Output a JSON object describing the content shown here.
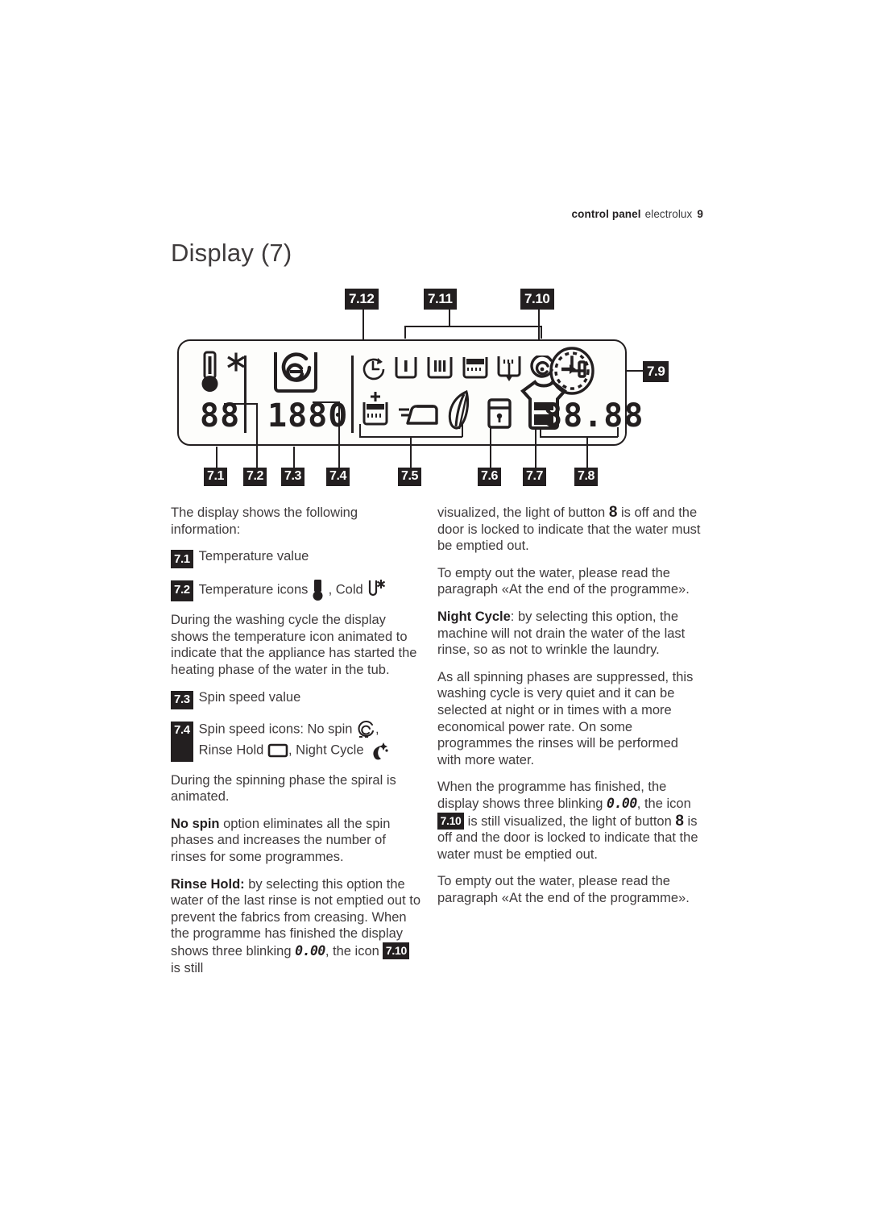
{
  "header": {
    "section": "control panel",
    "brand": "electrolux",
    "page_number": "9"
  },
  "title": "Display (7)",
  "figure": {
    "callouts_top": [
      "7.12",
      "7.11",
      "7.10"
    ],
    "callout_right": "7.9",
    "callouts_bottom": [
      "7.1",
      "7.2",
      "7.3",
      "7.4",
      "7.5",
      "7.6",
      "7.7",
      "7.8"
    ],
    "segments": {
      "temperature_value": "88",
      "spin_speed_value": "1880",
      "time_value": "88.88"
    },
    "icon_names": [
      "thermometer-icon",
      "snowflake-cold-icon",
      "spin-spiral-tub-icon",
      "prewash-clock-icon",
      "wash-phase-icon",
      "rinse-phase-icon",
      "extra-rinse-phase-icon",
      "drain-phase-icon",
      "spin-phase-icon",
      "door-lock-icon",
      "delay-start-clock-icon",
      "extra-rinse-plus-icon",
      "easy-iron-icon",
      "delicate-feather-icon",
      "child-lock-icon",
      "laundry-load-tshirt-icon"
    ]
  },
  "left_column": {
    "intro": "The display shows the following information:",
    "item_71": {
      "tag": "7.1",
      "text": "Temperature value"
    },
    "item_72": {
      "tag": "7.2",
      "text_before": "Temperature icons",
      "text_middle": ", Cold"
    },
    "para_heating": "During the washing cycle the display shows the temperature icon animated to indicate that the appliance has started the heating phase of the water in the tub.",
    "item_73": {
      "tag": "7.3",
      "text": "Spin speed value"
    },
    "item_74": {
      "tag": "7.4",
      "label": "Spin speed icons: No spin",
      "rinse_hold_label": "Rinse Hold",
      "night_cycle_label": "Night Cycle"
    },
    "para_spiral": "During the spinning phase the spiral is animated.",
    "para_nospin_bold": "No spin",
    "para_nospin_rest": " option eliminates all the spin phases and increases the number of rinses for some programmes.",
    "para_rinsehold_bold": "Rinse Hold:",
    "para_rinsehold_p1": " by selecting this option the water of the last rinse is not emptied out to prevent the fabrics from creasing. When the programme has finished the display shows three blinking ",
    "para_rinsehold_seg": "0.00",
    "para_rinsehold_p2": ", the icon ",
    "para_rinsehold_tag": "7.10",
    "para_rinsehold_p3": " is still"
  },
  "right_column": {
    "para_cont_p1": "visualized, the light of button ",
    "para_cont_num": "8",
    "para_cont_p2": " is off and the door is locked to indicate that the water must be emptied out.",
    "para_empty": "To empty out the water, please read the paragraph «At the end of the programme».",
    "night_bold": "Night Cycle",
    "night_rest": ": by selecting this option, the machine will not drain the water of the last rinse, so as not to wrinkle the laundry.",
    "para_quiet": "As all spinning phases are suppressed, this washing cycle is very quiet and it can be selected at night or in times with a more economical power rate. On some programmes the rinses will be performed with more water.",
    "para_finished_p1": "When the programme has finished, the display shows three blinking ",
    "para_finished_seg": "0.00",
    "para_finished_p2": ", the icon ",
    "para_finished_tag": "7.10",
    "para_finished_p3": " is still visualized, the light of button ",
    "para_finished_num": "8",
    "para_finished_p4": " is off and the door is locked to indicate that the water must be emptied out.",
    "para_empty2": "To empty out the water, please read the paragraph «At the end of the programme»."
  }
}
